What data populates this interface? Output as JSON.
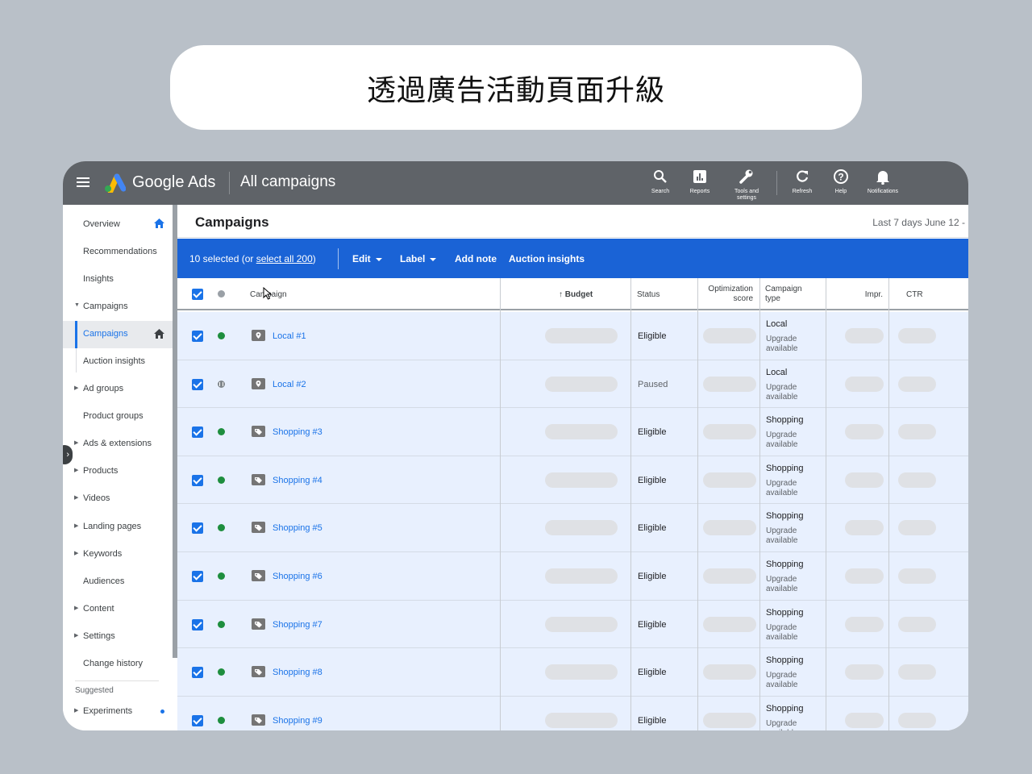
{
  "banner": {
    "title": "透過廣告活動頁面升級"
  },
  "topbar": {
    "brand": "Google Ads",
    "page": "All campaigns",
    "tools": [
      {
        "label": "Search",
        "icon": "search-icon"
      },
      {
        "label": "Reports",
        "icon": "reports-icon"
      },
      {
        "label": "Tools and\nsettings",
        "icon": "wrench-icon"
      },
      {
        "label": "Refresh",
        "icon": "refresh-icon"
      },
      {
        "label": "Help",
        "icon": "help-icon"
      },
      {
        "label": "Notifications",
        "icon": "bell-icon"
      }
    ]
  },
  "sidebar": {
    "items": [
      {
        "label": "Overview"
      },
      {
        "label": "Recommendations"
      },
      {
        "label": "Insights"
      },
      {
        "label": "Campaigns"
      },
      {
        "label": "Campaigns"
      },
      {
        "label": "Auction insights"
      },
      {
        "label": "Ad groups"
      },
      {
        "label": "Product groups"
      },
      {
        "label": "Ads & extensions"
      },
      {
        "label": "Products"
      },
      {
        "label": "Videos"
      },
      {
        "label": "Landing pages"
      },
      {
        "label": "Keywords"
      },
      {
        "label": "Audiences"
      },
      {
        "label": "Content"
      },
      {
        "label": "Settings"
      },
      {
        "label": "Change history"
      },
      {
        "label": "Experiments"
      }
    ],
    "suggested_label": "Suggested"
  },
  "main": {
    "title": "Campaigns",
    "date_range": "Last 7 days   June 12 -",
    "selection": {
      "prefix": "10 selected (or ",
      "link": "select all 200",
      "suffix": ")",
      "actions": [
        "Edit",
        "Label",
        "Add note",
        "Auction insights"
      ]
    },
    "columns": {
      "campaign": "Campaign",
      "budget": "Budget",
      "status": "Status",
      "opt_score_1": "Optimization",
      "opt_score_2": "score",
      "type_1": "Campaign",
      "type_2": "type",
      "impr": "Impr.",
      "ctr": "CTR"
    },
    "rows": [
      {
        "name": "Local #1",
        "status": "Eligible",
        "type": "Local",
        "note": "Upgrade available",
        "state": "enabled"
      },
      {
        "name": "Local #2",
        "status": "Paused",
        "type": "Local",
        "note": "Upgrade available",
        "state": "paused"
      },
      {
        "name": "Shopping #3",
        "status": "Eligible",
        "type": "Shopping",
        "note": "Upgrade available",
        "state": "enabled"
      },
      {
        "name": "Shopping #4",
        "status": "Eligible",
        "type": "Shopping",
        "note": "Upgrade available",
        "state": "enabled"
      },
      {
        "name": "Shopping #5",
        "status": "Eligible",
        "type": "Shopping",
        "note": "Upgrade available",
        "state": "enabled"
      },
      {
        "name": "Shopping #6",
        "status": "Eligible",
        "type": "Shopping",
        "note": "Upgrade available",
        "state": "enabled"
      },
      {
        "name": "Shopping #7",
        "status": "Eligible",
        "type": "Shopping",
        "note": "Upgrade available",
        "state": "enabled"
      },
      {
        "name": "Shopping #8",
        "status": "Eligible",
        "type": "Shopping",
        "note": "Upgrade available",
        "state": "enabled"
      },
      {
        "name": "Shopping #9",
        "status": "Eligible",
        "type": "Shopping",
        "note": "Upgrade available",
        "state": "enabled"
      }
    ]
  },
  "colors": {
    "accent": "#1a63d6",
    "topbar": "#5f6368",
    "row_selected": "#e8f0fe",
    "enabled": "#1e8e3e"
  }
}
